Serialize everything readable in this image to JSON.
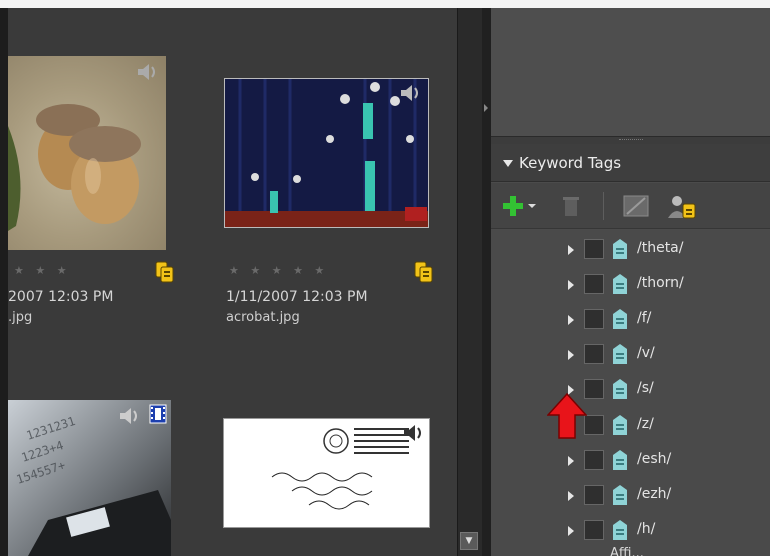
{
  "media": [
    {
      "stars": "★ ★ ★",
      "meta": "2007 12:03 PM",
      "file": ".jpg"
    },
    {
      "stars": "★ ★ ★ ★ ★",
      "meta": "1/11/2007 12:03 PM",
      "file": "acrobat.jpg"
    }
  ],
  "keyword_panel": {
    "title": "Keyword Tags",
    "tags": [
      "/theta/",
      "/thorn/",
      "/f/",
      "/v/",
      "/s/",
      "/z/",
      "/esh/",
      "/ezh/",
      "/h/"
    ],
    "next_partial": "Affi..."
  },
  "colors": {
    "accent_green": "#33c133",
    "tag_teal": "#8fd3d6",
    "badge_yellow": "#f2c318",
    "arrow_red": "#e8141a"
  },
  "icons": [
    "audio-icon",
    "video-icon",
    "tag-badge-icon",
    "add-icon",
    "delete-icon",
    "edit-icon",
    "person-tag-icon",
    "keyword-tag-icon"
  ]
}
